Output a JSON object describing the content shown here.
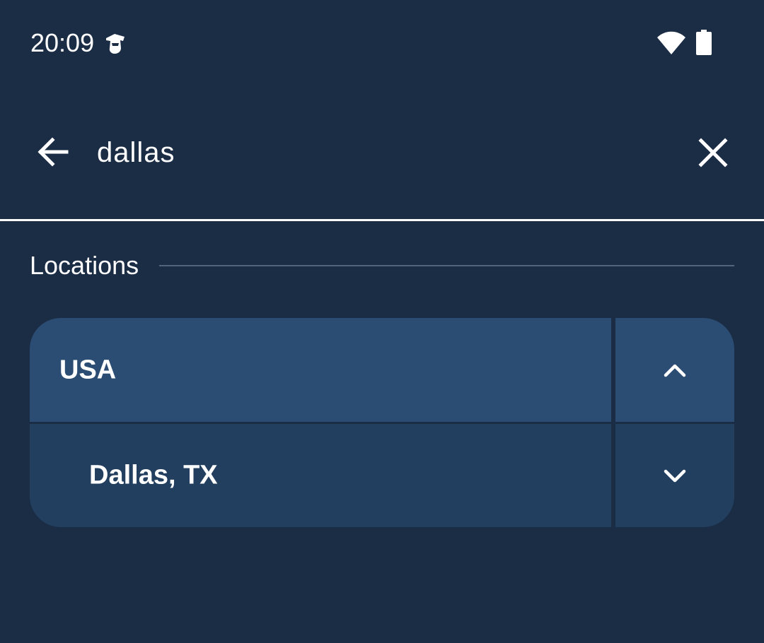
{
  "status_bar": {
    "time": "20:09",
    "app_icon": "app-notification-icon",
    "wifi_icon": "wifi-icon",
    "battery_icon": "battery-icon"
  },
  "search": {
    "query": "dallas",
    "back_icon": "arrow-back-icon",
    "clear_icon": "close-icon"
  },
  "locations_section": {
    "title": "Locations",
    "rows": [
      {
        "label": "USA",
        "toggle_icon": "chevron-up-icon"
      },
      {
        "label": "Dallas, TX",
        "toggle_icon": "chevron-down-icon"
      }
    ]
  },
  "colors": {
    "background": "#1b2c45",
    "row_country": "#2b4d73",
    "row_city": "#233f60",
    "text": "#ffffff"
  }
}
